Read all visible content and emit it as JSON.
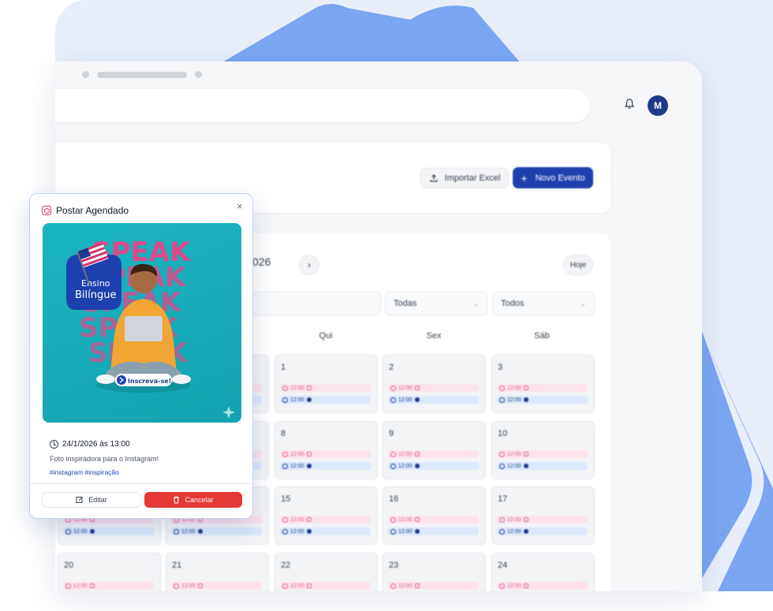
{
  "window": {
    "avatar_initial": "M"
  },
  "toolbar": {
    "import_label": "Importar Excel",
    "new_event_label": "Novo Evento"
  },
  "calendar": {
    "month_label": "026",
    "today_label": "Hoje",
    "filter_type_value": "Todas",
    "filter_network_value": "Todos",
    "day_names": [
      "Qui",
      "Sex",
      "Sáb"
    ],
    "weeks": [
      [
        "",
        "",
        "1",
        "2",
        "3"
      ],
      [
        "",
        "",
        "8",
        "9",
        "10"
      ],
      [
        "",
        "",
        "15",
        "16",
        "17"
      ],
      [
        "20",
        "21",
        "22",
        "23",
        "24"
      ]
    ],
    "event_time": "12:00"
  },
  "popup": {
    "title": "Postar Agendado",
    "close_label": "×",
    "date_time": "24/1/2026 às 13:00",
    "description": "Foto inspiradora para o Instagram!",
    "hashtags": "#instagram #inspiração",
    "edit_label": "Editar",
    "cancel_label": "Cancelar",
    "image_badge_line1": "Ensino",
    "image_badge_line2": "Bilíngue",
    "image_cta": "Inscreva-se!",
    "image_bg_text": "SPEAK"
  },
  "colors": {
    "brand_blue": "#1e40af",
    "cancel_red": "#e53935",
    "instagram_pink": "#e0608f",
    "preview_teal": "#1ab5c0"
  }
}
